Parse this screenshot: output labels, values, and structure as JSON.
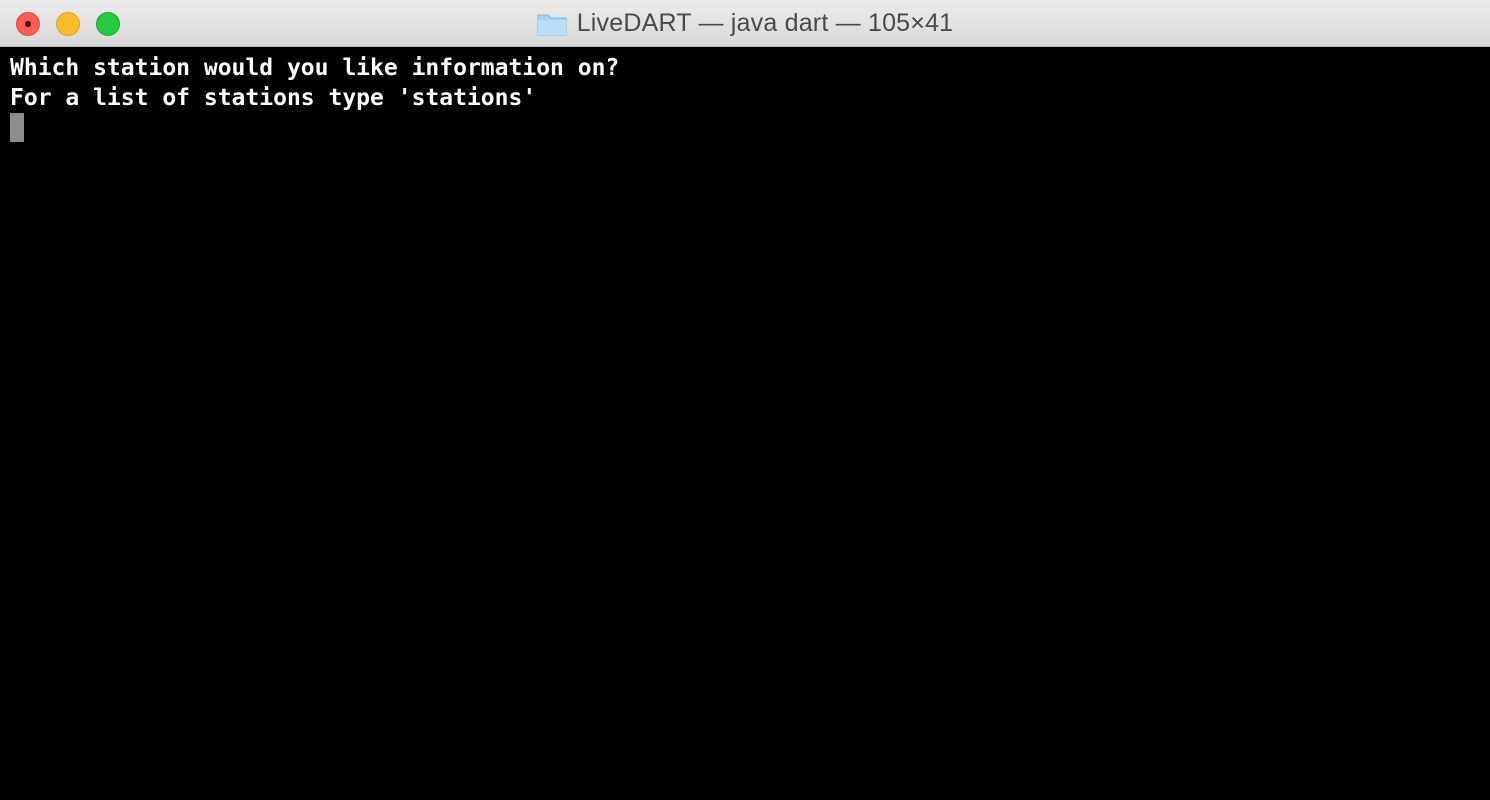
{
  "window": {
    "title": "LiveDART — java dart — 105×41",
    "title_icon": "folder-icon",
    "traffic_lights": {
      "close": "#fc5f57",
      "minimize": "#fdbc2e",
      "zoom": "#28c840"
    }
  },
  "terminal": {
    "lines": [
      "Which station would you like information on?",
      "For a list of stations type 'stations'"
    ],
    "background": "#000000",
    "text_color": "#ffffff",
    "cursor_color": "#8e8e8e"
  }
}
